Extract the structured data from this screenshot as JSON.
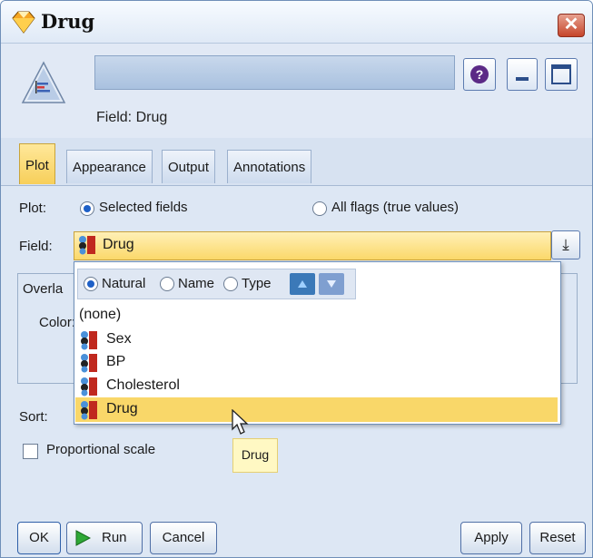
{
  "window": {
    "title": "Drug"
  },
  "header": {
    "field_caption": "Field: Drug"
  },
  "tabs": [
    {
      "label": "Plot"
    },
    {
      "label": "Appearance"
    },
    {
      "label": "Output"
    },
    {
      "label": "Annotations"
    }
  ],
  "plot": {
    "label": "Plot:",
    "option_selected_fields": "Selected fields",
    "option_all_flags": "All flags (true values)"
  },
  "field": {
    "label": "Field:",
    "value": "Drug"
  },
  "overlay": {
    "label": "Overla",
    "color_label": "Color:"
  },
  "sort_options": {
    "natural": "Natural",
    "name": "Name",
    "type": "Type"
  },
  "dropdown_items": [
    {
      "label": "(none)"
    },
    {
      "label": "Sex"
    },
    {
      "label": "BP"
    },
    {
      "label": "Cholesterol"
    },
    {
      "label": "Drug"
    }
  ],
  "sort": {
    "label": "Sort:"
  },
  "proportional_scale": {
    "label": "Proportional scale"
  },
  "tooltip": {
    "text": "Drug"
  },
  "buttons": {
    "ok": "OK",
    "run": "Run",
    "cancel": "Cancel",
    "apply": "Apply",
    "reset": "Reset"
  },
  "colors": {
    "selected_highlight": "#f9d769",
    "accent_blue": "#1e60c7"
  },
  "icons": {
    "window": "diamond-node-icon",
    "node": "distribution-node-icon",
    "field_type": "flag-field-icon"
  }
}
